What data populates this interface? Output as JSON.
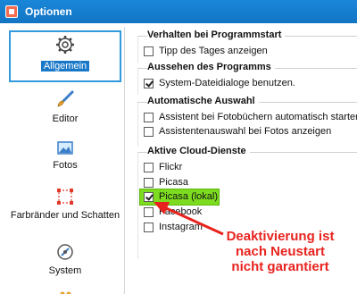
{
  "window": {
    "title": "Optionen"
  },
  "sidebar": {
    "items": [
      {
        "label": "Allgemein",
        "icon": "gear-icon"
      },
      {
        "label": "Editor",
        "icon": "brush-icon"
      },
      {
        "label": "Fotos",
        "icon": "photo-icon"
      },
      {
        "label": "Farbränder und Schatten",
        "icon": "frame-border-icon"
      },
      {
        "label": "System",
        "icon": "system-icon"
      }
    ]
  },
  "groups": [
    {
      "title": "Verhalten bei Programmstart",
      "options": [
        {
          "label": "Tipp des Tages anzeigen",
          "checked": false
        }
      ]
    },
    {
      "title": "Aussehen des Programms",
      "options": [
        {
          "label": "System-Dateidialoge benutzen.",
          "checked": true
        }
      ]
    },
    {
      "title": "Automatische Auswahl",
      "options": [
        {
          "label": "Assistent bei Fotobüchern automatisch starten",
          "checked": false
        },
        {
          "label": "Assistentenauswahl bei Fotos anzeigen",
          "checked": false
        }
      ]
    },
    {
      "title": "Aktive Cloud-Dienste",
      "options": [
        {
          "label": "Flickr",
          "checked": false
        },
        {
          "label": "Picasa",
          "checked": false
        },
        {
          "label": "Picasa (lokal)",
          "checked": true
        },
        {
          "label": "Facebook",
          "checked": false
        },
        {
          "label": "Instagram",
          "checked": false
        }
      ]
    }
  ],
  "annotation": {
    "line1": "Deaktivierung ist",
    "line2": "nach Neustart",
    "line3": "nicht garantiert",
    "color": "#e8231e"
  },
  "colors": {
    "titlebar": "#1a86d8",
    "selection": "#1a78c8",
    "highlight": "#7ddc1f"
  }
}
